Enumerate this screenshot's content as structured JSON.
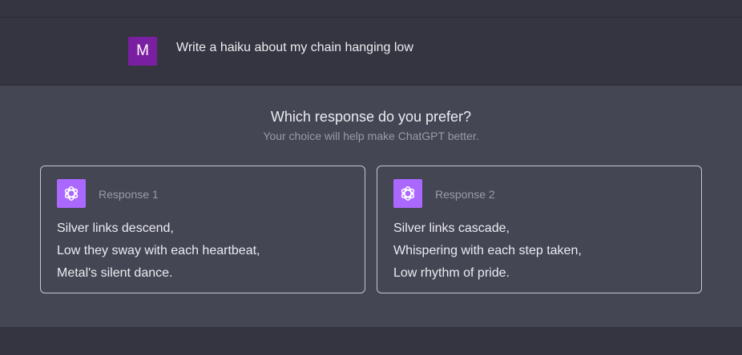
{
  "user": {
    "avatar_letter": "M",
    "avatar_color": "#7b1fa2",
    "message": "Write a haiku about my chain hanging low"
  },
  "comparison": {
    "question": "Which response do you prefer?",
    "subtitle": "Your choice will help make ChatGPT better.",
    "icon": "openai-logo-icon",
    "icon_color": "#ab68ff",
    "responses": [
      {
        "label": "Response 1",
        "lines": [
          "Silver links descend,",
          "Low they sway with each heartbeat,",
          "Metal's silent dance."
        ]
      },
      {
        "label": "Response 2",
        "lines": [
          "Silver links cascade,",
          "Whispering with each step taken,",
          "Low rhythm of pride."
        ]
      }
    ]
  }
}
